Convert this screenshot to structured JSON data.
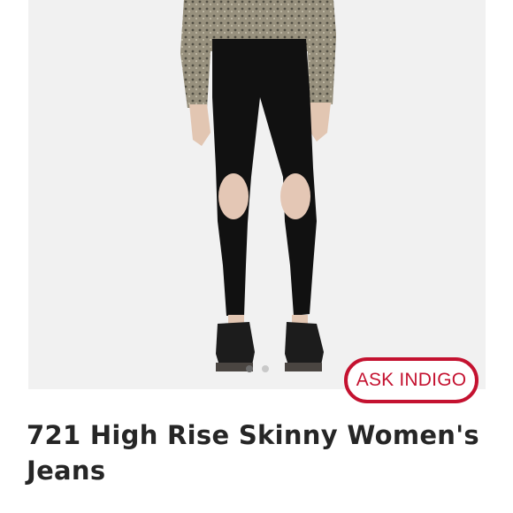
{
  "product": {
    "title": "721 High Rise Skinny Women's Jeans",
    "image_alt": "Model wearing black high rise skinny jeans with ripped knees and black sneakers"
  },
  "carousel": {
    "dot_count": 2,
    "active_index": 0
  },
  "assistant": {
    "label": "ASK INDIGO"
  },
  "colors": {
    "accent": "#c41230",
    "title_text": "#262626",
    "image_background": "#f1f1f1"
  }
}
